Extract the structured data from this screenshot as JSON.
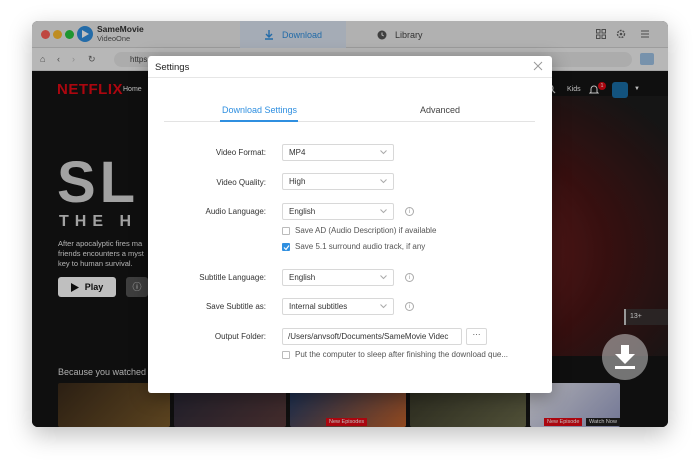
{
  "app": {
    "name": "SameMovie",
    "subtitle": "VideoOne"
  },
  "tabs": {
    "download": "Download",
    "library": "Library"
  },
  "addressbar": {
    "url": "https://"
  },
  "netflix": {
    "logo": "NETFLIX",
    "home": "Home",
    "kids": "Kids",
    "badge": "1",
    "hero_title": "SL",
    "hero_subtitle": "THE H",
    "hero_description": "After apocalyptic fires ma friends encounters a myst key to human survival.",
    "play_label": "Play",
    "rating": "13+",
    "row_title": "Because you watched",
    "thumb_tags": [
      "New Episodes",
      "New Episode",
      "Watch Now"
    ]
  },
  "dialog": {
    "title": "Settings",
    "tabs": {
      "download_settings": "Download Settings",
      "advanced": "Advanced"
    },
    "fields": {
      "video_format": {
        "label": "Video Format:",
        "value": "MP4"
      },
      "video_quality": {
        "label": "Video Quality:",
        "value": "High"
      },
      "audio_language": {
        "label": "Audio Language:",
        "value": "English"
      },
      "subtitle_language": {
        "label": "Subtitle Language:",
        "value": "English"
      },
      "save_subtitle_as": {
        "label": "Save Subtitle as:",
        "value": "Internal subtitles"
      },
      "output_folder": {
        "label": "Output Folder:",
        "value": "/Users/anvsoft/Documents/SameMovie Videc",
        "browse": "···"
      }
    },
    "checkboxes": {
      "audio_description": {
        "label": "Save AD (Audio Description) if available",
        "checked": false
      },
      "surround": {
        "label": "Save 5.1 surround audio track, if any",
        "checked": true
      },
      "sleep": {
        "label": "Put the computer to sleep after finishing the download que...",
        "checked": false
      }
    }
  },
  "colors": {
    "accent": "#2f8fe0",
    "netflix_red": "#e50914"
  }
}
